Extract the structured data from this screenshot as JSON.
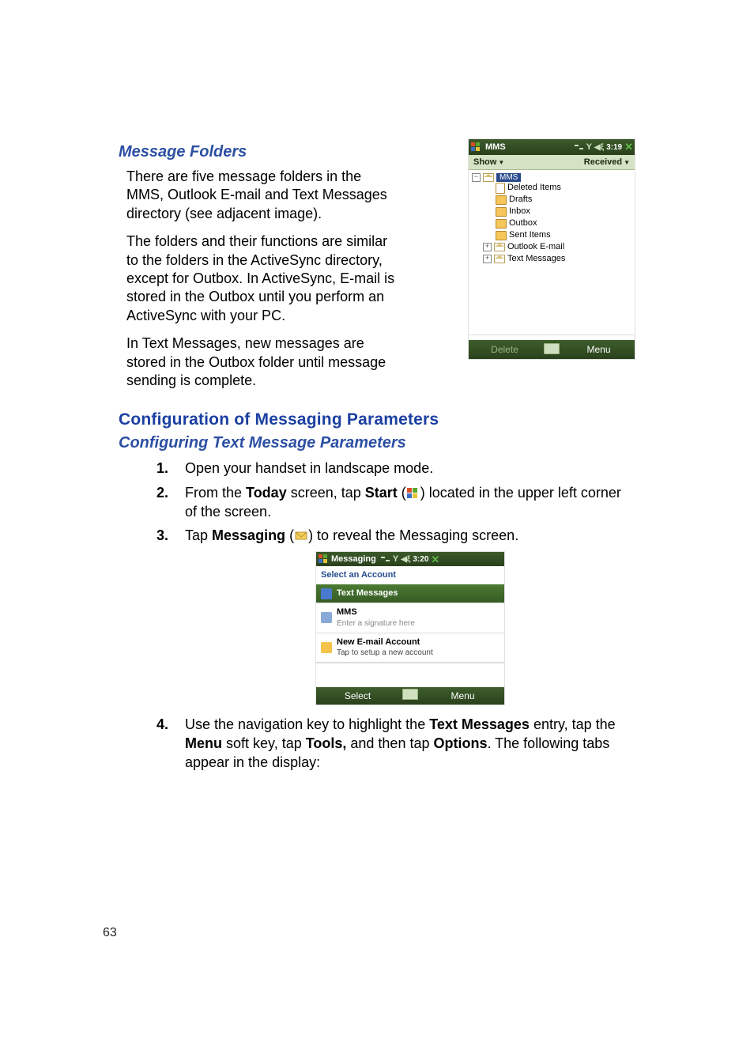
{
  "section": {
    "message_folders_heading": "Message Folders",
    "mf_p1": "There are five message folders in the MMS, Outlook E-mail and Text Messages directory (see adjacent image).",
    "mf_p2": "The folders and their functions are similar to the folders in the ActiveSync directory, except for Outbox. In ActiveSync, E-mail is stored in the Outbox until you perform an ActiveSync with your PC.",
    "mf_p3": "In Text Messages, new messages are stored in the Outbox folder until message sending is complete.",
    "config_heading": "Configuration of Messaging Parameters",
    "config_sub_heading": "Configuring Text Message Parameters"
  },
  "steps": {
    "s1": "Open your handset in landscape mode.",
    "s2_a": "From the ",
    "s2_today": "Today",
    "s2_b": " screen, tap ",
    "s2_start": "Start",
    "s2_c": " (",
    "s2_d": ") located in the upper left corner of the screen.",
    "s3_a": "Tap ",
    "s3_msg": "Messaging",
    "s3_b": " (",
    "s3_c": ") to reveal the Messaging screen.",
    "s4_a": "Use the navigation key to highlight the ",
    "s4_tm": "Text Messages",
    "s4_b": " entry, tap the ",
    "s4_menu": "Menu",
    "s4_c": " soft key, tap ",
    "s4_tools": "Tools,",
    "s4_d": " and then tap ",
    "s4_options": "Options",
    "s4_e": ". The following tabs appear in the display:"
  },
  "page_number": "63",
  "device1": {
    "title": "MMS",
    "time": "3:19",
    "show": "Show",
    "received": "Received",
    "root": "MMS",
    "folders": {
      "deleted": "Deleted Items",
      "drafts": "Drafts",
      "inbox": "Inbox",
      "outbox": "Outbox",
      "sent": "Sent Items",
      "outlook": "Outlook E-mail",
      "textmsg": "Text Messages"
    },
    "soft_delete": "Delete",
    "soft_menu": "Menu"
  },
  "device2": {
    "title": "Messaging",
    "time": "3:20",
    "select_account": "Select an Account",
    "tm": "Text Messages",
    "mms": "MMS",
    "mms_sub": "Enter a signature here",
    "newacct": "New E-mail Account",
    "newacct_sub": "Tap to setup a new account",
    "soft_select": "Select",
    "soft_menu": "Menu"
  }
}
